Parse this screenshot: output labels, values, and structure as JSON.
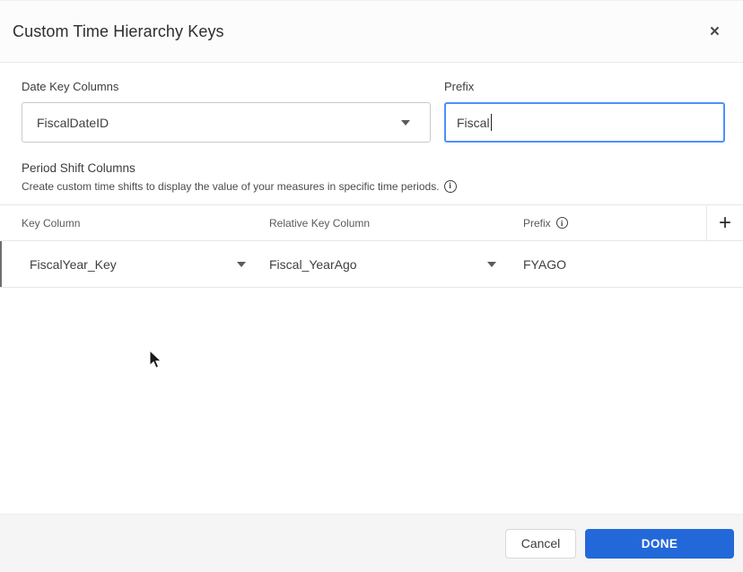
{
  "dialog": {
    "title": "Custom Time Hierarchy Keys",
    "close_icon": "×"
  },
  "form": {
    "date_key_label": "Date Key Columns",
    "date_key_value": "FiscalDateID",
    "prefix_label": "Prefix",
    "prefix_value": "Fiscal"
  },
  "period_shift": {
    "title": "Period Shift Columns",
    "description": "Create custom time shifts to display the value of your measures in specific time periods.",
    "info_icon": "i"
  },
  "table": {
    "headers": {
      "key_column": "Key Column",
      "relative_key_column": "Relative Key Column",
      "prefix": "Prefix",
      "add_label": "+"
    },
    "rows": [
      {
        "key_column": "FiscalYear_Key",
        "relative_key_column": "Fiscal_YearAgo",
        "prefix": "FYAGO"
      }
    ]
  },
  "footer": {
    "cancel_label": "Cancel",
    "done_label": "DONE"
  },
  "colors": {
    "accent_blue": "#2368d9",
    "focus_border": "#4d90fe",
    "footer_bg": "#f5f5f5"
  }
}
